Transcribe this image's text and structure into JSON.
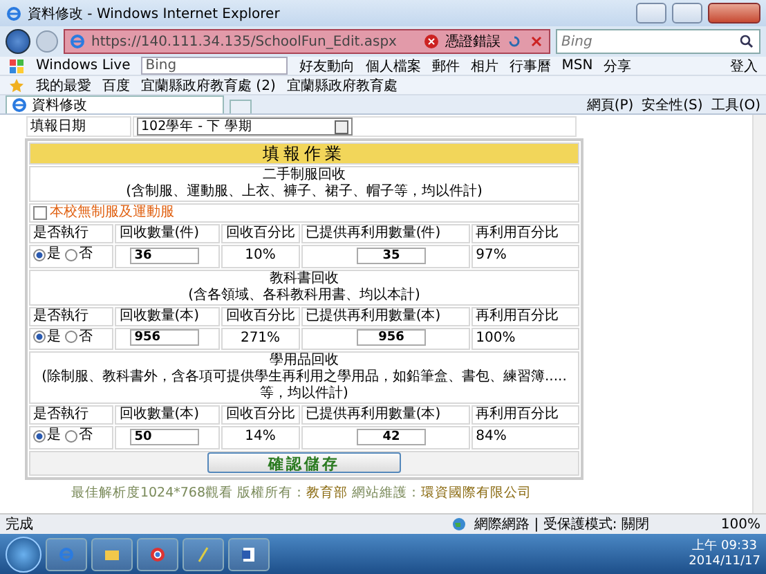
{
  "window": {
    "title": "資料修改 - Windows Internet Explorer"
  },
  "address_bar": {
    "url": "https://140.111.34.135/SchoolFun_Edit.aspx",
    "cert_error": "憑證錯誤",
    "search_placeholder": "Bing"
  },
  "links_bar": {
    "brand": "Windows Live",
    "search_value": "Bing",
    "items": [
      "好友動向",
      "個人檔案",
      "郵件",
      "相片",
      "行事曆",
      "MSN",
      "分享"
    ],
    "sign_in": "登入"
  },
  "favorites_bar": {
    "label": "我的最愛",
    "items": [
      "百度",
      "宜蘭縣政府教育處 (2)",
      "宜蘭縣政府教育處"
    ]
  },
  "tab": {
    "label": "資料修改"
  },
  "command_bar": [
    "網頁(P)",
    "安全性(S)",
    "工具(O)"
  ],
  "form": {
    "date_label": "填報日期",
    "date_value": "102學年 - 下 學期",
    "heading": "填報作業",
    "sections": [
      {
        "title": "二手制服回收",
        "subtitle": "(含制服、運動服、上衣、褲子、裙子、帽子等，均以件計)",
        "checkbox": {
          "label": "本校無制服及運動服",
          "checked": false
        },
        "columns": [
          "是否執行",
          "回收數量(件)",
          "回收百分比",
          "已提供再利用數量(件)",
          "再利用百分比"
        ],
        "options": [
          {
            "label": "是",
            "selected": true
          },
          {
            "label": "否",
            "selected": false
          }
        ],
        "count": "36",
        "percent": "10%",
        "reused": "35",
        "reuse_percent": "97%"
      },
      {
        "title": "教科書回收",
        "subtitle": "(含各領域、各科教科用書、均以本計)",
        "columns": [
          "是否執行",
          "回收數量(本)",
          "回收百分比",
          "已提供再利用數量(本)",
          "再利用百分比"
        ],
        "options": [
          {
            "label": "是",
            "selected": true
          },
          {
            "label": "否",
            "selected": false
          }
        ],
        "count": "956",
        "percent": "271%",
        "reused": "956",
        "reuse_percent": "100%"
      },
      {
        "title": "學用品回收",
        "subtitle": "(除制服、教科書外，含各項可提供學生再利用之學用品，如鉛筆盒、書包、練習簿.....等，均以件計)",
        "columns": [
          "是否執行",
          "回收數量(本)",
          "回收百分比",
          "已提供再利用數量(本)",
          "再利用百分比"
        ],
        "options": [
          {
            "label": "是",
            "selected": true
          },
          {
            "label": "否",
            "selected": false
          }
        ],
        "count": "50",
        "percent": "14%",
        "reused": "42",
        "reuse_percent": "84%"
      }
    ],
    "save": "確認儲存",
    "footer": {
      "text": "最佳解析度1024*768觀看 版權所有：",
      "owner": "教育部",
      "maint_label": " 網站維護：",
      "maintainer": "環資國際有限公司"
    }
  },
  "status_bar": {
    "status": "完成",
    "zone": "網際網路 | 受保護模式: 關閉",
    "zoom": "100%"
  },
  "taskbar": {
    "time": "上午 09:33",
    "date": "2014/11/17"
  }
}
